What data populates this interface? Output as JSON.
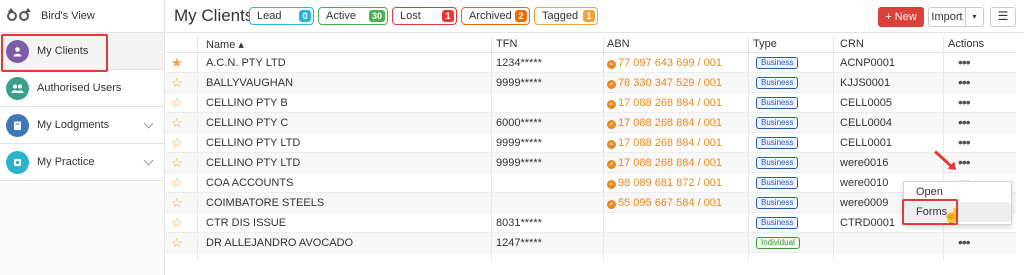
{
  "sidebar": {
    "top_label": "Bird's View",
    "items": [
      {
        "label": "My Clients",
        "icon": "user-icon",
        "color": "#7b5ea7"
      },
      {
        "label": "Authorised Users",
        "icon": "users-icon",
        "color": "#3aa08a"
      },
      {
        "label": "My Lodgments",
        "icon": "book-icon",
        "color": "#3f79b5"
      },
      {
        "label": "My Practice",
        "icon": "practice-icon",
        "color": "#2ab3c9"
      }
    ]
  },
  "header": {
    "title": "My Clients",
    "filters": [
      {
        "label": "Lead",
        "count": "0",
        "color": "#29b6d8"
      },
      {
        "label": "Active",
        "count": "30",
        "color": "#4caf50"
      },
      {
        "label": "Lost",
        "count": "1",
        "color": "#e53935"
      },
      {
        "label": "Archived",
        "count": "2",
        "color": "#ef6c00"
      },
      {
        "label": "Tagged",
        "count": "1",
        "color": "#f0a33a"
      }
    ],
    "new_label": "+ New",
    "import_label": "Import",
    "caret": "▾",
    "menu": "☰"
  },
  "columns": [
    "Name ▴",
    "TFN",
    "ABN",
    "Type",
    "CRN",
    "Actions"
  ],
  "rows": [
    {
      "starred": true,
      "name": "A.C.N. PTY LTD",
      "tfn": "1234*****",
      "abn": "77 097 643 699 / 001",
      "type": "Business",
      "crn": "ACNP0001"
    },
    {
      "starred": false,
      "name": "BALLYVAUGHAN",
      "tfn": "9999*****",
      "abn": "78 330 347 529 / 001",
      "type": "Business",
      "crn": "KJJS0001"
    },
    {
      "starred": false,
      "name": "CELLINO PTY B",
      "tfn": "",
      "abn": "17 088 268 884 / 001",
      "type": "Business",
      "crn": "CELL0005"
    },
    {
      "starred": false,
      "name": "CELLINO PTY C",
      "tfn": "6000*****",
      "abn": "17 088 268 884 / 001",
      "type": "Business",
      "crn": "CELL0004"
    },
    {
      "starred": false,
      "name": "CELLINO PTY LTD",
      "tfn": "9999*****",
      "abn": "17 088 268 884 / 001",
      "type": "Business",
      "crn": "CELL0001"
    },
    {
      "starred": false,
      "name": "CELLINO PTY LTD",
      "tfn": "9999*****",
      "abn": "17 088 268 884 / 001",
      "type": "Business",
      "crn": "were0016"
    },
    {
      "starred": false,
      "name": "COA ACCOUNTS",
      "tfn": "",
      "abn": "98 089 681 872 / 001",
      "type": "Business",
      "crn": "were0010"
    },
    {
      "starred": false,
      "name": "COIMBATORE STEELS",
      "tfn": "",
      "abn": "55 095 667 584 / 001",
      "type": "Business",
      "crn": "were0009"
    },
    {
      "starred": false,
      "name": "CTR DIS ISSUE",
      "tfn": "8031*****",
      "abn": "",
      "type": "Business",
      "crn": "CTRD0001"
    },
    {
      "starred": false,
      "name": "DR ALLEJANDRO AVOCADO",
      "tfn": "1247*****",
      "abn": "",
      "type": "Individual",
      "crn": ""
    }
  ],
  "actions_glyph": "•••",
  "dropdown": {
    "items": [
      "Open",
      "Forms"
    ]
  }
}
